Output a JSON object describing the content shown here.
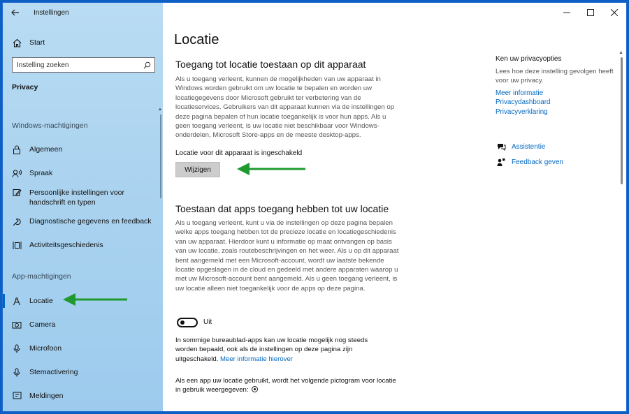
{
  "window": {
    "title": "Instellingen"
  },
  "sidebar": {
    "start_label": "Start",
    "search_placeholder": "Instelling zoeken",
    "category": "Privacy",
    "windows_section": "Windows-machtigingen",
    "windows_items": [
      {
        "label": "Algemeen",
        "icon": "lock-icon"
      },
      {
        "label": "Spraak",
        "icon": "speech-icon"
      },
      {
        "label": "Persoonlijke instellingen voor handschrift en typen",
        "icon": "handwriting-icon"
      },
      {
        "label": "Diagnostische gegevens en feedback",
        "icon": "diagnostics-icon"
      },
      {
        "label": "Activiteitsgeschiedenis",
        "icon": "activity-icon"
      }
    ],
    "app_section": "App-machtigingen",
    "app_items": [
      {
        "label": "Locatie",
        "icon": "location-icon",
        "active": true
      },
      {
        "label": "Camera",
        "icon": "camera-icon"
      },
      {
        "label": "Microfoon",
        "icon": "microphone-icon"
      },
      {
        "label": "Stemactivering",
        "icon": "voice-activation-icon"
      },
      {
        "label": "Meldingen",
        "icon": "notifications-icon"
      }
    ]
  },
  "main": {
    "page_title": "Locatie",
    "section1_title": "Toegang tot locatie toestaan op dit apparaat",
    "section1_text": "Als u toegang verleent, kunnen de mogelijkheden van uw apparaat in Windows worden gebruikt om uw locatie te bepalen en worden uw locatiegegevens door Microsoft gebruikt ter verbetering van de locatieservices. Gebruikers van dit apparaat kunnen via de instellingen op deze pagina bepalen of hun locatie toegankelijk is voor hun apps. Als u geen toegang verleent, is uw locatie niet beschikbaar voor Windows-onderdelen, Microsoft Store-apps en de meeste desktop-apps.",
    "status_text": "Locatie voor dit apparaat is ingeschakeld",
    "change_button": "Wijzigen",
    "section2_title": "Toestaan dat apps toegang hebben tot uw locatie",
    "section2_text": "Als u toegang verleent, kunt u via de instellingen op deze pagina bepalen welke apps toegang hebben tot de precieze locatie en locatiegeschiedenis van uw apparaat. Hierdoor kunt u informatie op maat ontvangen op basis van uw locatie, zoals routebeschrijvingen en het weer. Als u op dit apparaat bent aangemeld met een Microsoft-account, wordt uw laatste bekende locatie opgeslagen in de cloud en gedeeld met andere apparaten waarop u met uw Microsoft-account bent aangemeld. Als u geen toegang verleent, is uw locatie alleen niet toegankelijk voor de apps op deze pagina.",
    "toggle_label": "Uit",
    "desktop_note": "In sommige bureaublad-apps kan uw locatie mogelijk nog steeds worden bepaald, ook als de instellingen op deze pagina zijn uitgeschakeld.",
    "desktop_note_link": "Meer informatie hierover",
    "icon_note": "Als een app uw locatie gebruikt, wordt het volgende pictogram voor locatie in gebruik weergegeven:"
  },
  "right": {
    "title": "Ken uw privacyopties",
    "text": "Lees hoe deze instelling gevolgen heeft voor uw privacy.",
    "links": [
      "Meer informatie",
      "Privacydashboard",
      "Privacyverklaring"
    ],
    "help": [
      {
        "label": "Assistentie",
        "icon": "assist-icon"
      },
      {
        "label": "Feedback geven",
        "icon": "feedback-icon"
      }
    ]
  },
  "colors": {
    "accent": "#0067c0",
    "arrow": "#1f9a2e",
    "sidebar": "#a9d2ef"
  }
}
